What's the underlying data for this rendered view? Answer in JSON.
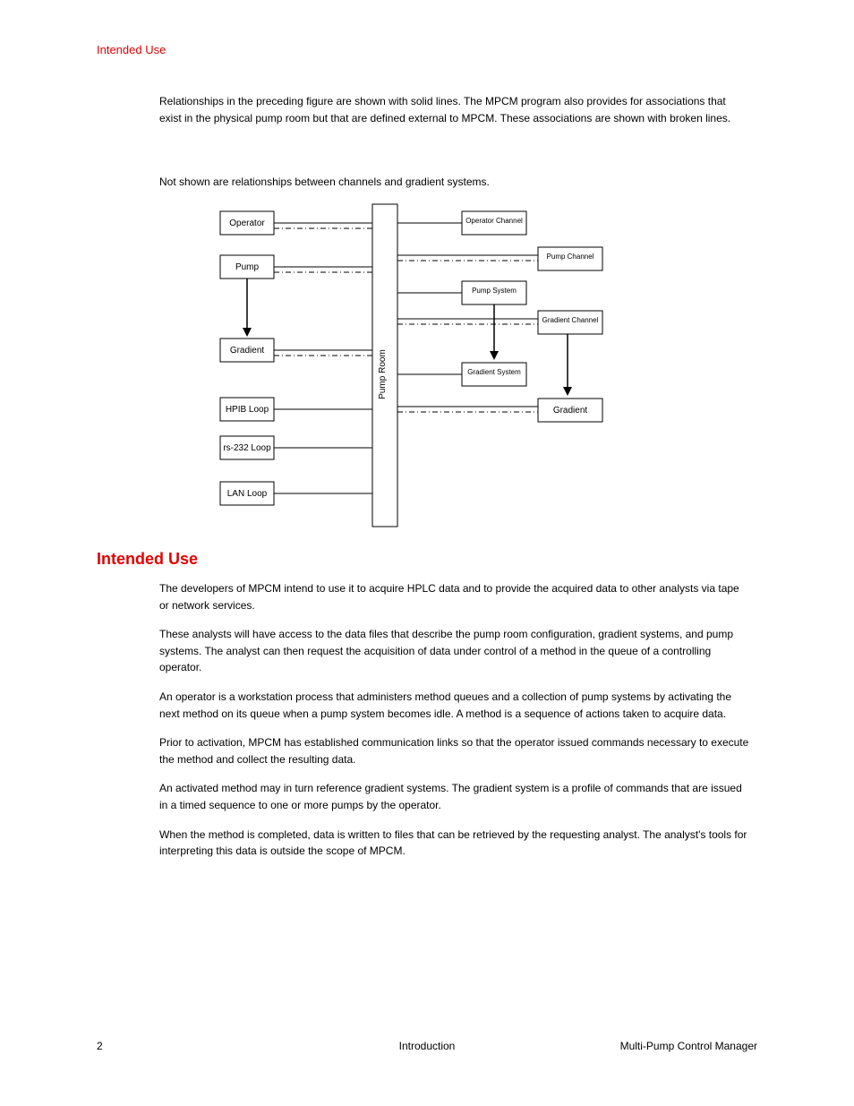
{
  "runningHead": "Intended Use",
  "intro1": "Relationships in the preceding figure are shown with solid lines. The MPCM program also provides for associations that exist in the physical pump room but that are defined external to MPCM. These associations are shown with broken lines.",
  "intro2": "Not shown are relationships between channels and gradient systems.",
  "diagram": {
    "hub": "Pump Room",
    "op": "Operator",
    "opch": "Operator Channel",
    "pump": "Pump",
    "pumpch": "Pump Channel",
    "pumpsys": "Pump System",
    "grad": "Gradient",
    "gradch": "Gradient Channel",
    "gradsys": "Gradient System",
    "hpib": "HPIB Loop",
    "rs": "rs-232 Loop",
    "lan": "LAN Loop"
  },
  "heading": "Intended Use",
  "p1": "The developers of MPCM intend to use it to acquire HPLC data and to provide the acquired data to other analysts via tape or network services.",
  "p2": "These analysts will have access to the data files that describe the pump room configuration, gradient systems, and pump systems. The analyst can then request the acquisition of data under control of a method in the queue of a controlling operator.",
  "p3": "An operator is a workstation process that administers method queues and a collection of pump systems by activating the next method on its queue when a pump system becomes idle. A method is a sequence of actions taken to acquire data.",
  "p4": "Prior to activation, MPCM has established communication links so that the operator issued commands necessary to execute the method and collect the resulting data.",
  "p5": "An activated method may in turn reference gradient systems. The gradient system is a profile of commands that are issued in a timed sequence to one or more pumps by the operator.",
  "p6": "When the method is completed, data is written to files that can be retrieved by the requesting analyst. The analyst's tools for interpreting this data is outside the scope of MPCM.",
  "footer": {
    "page": "2",
    "section": "Introduction",
    "doc": "Multi-Pump Control Manager"
  }
}
